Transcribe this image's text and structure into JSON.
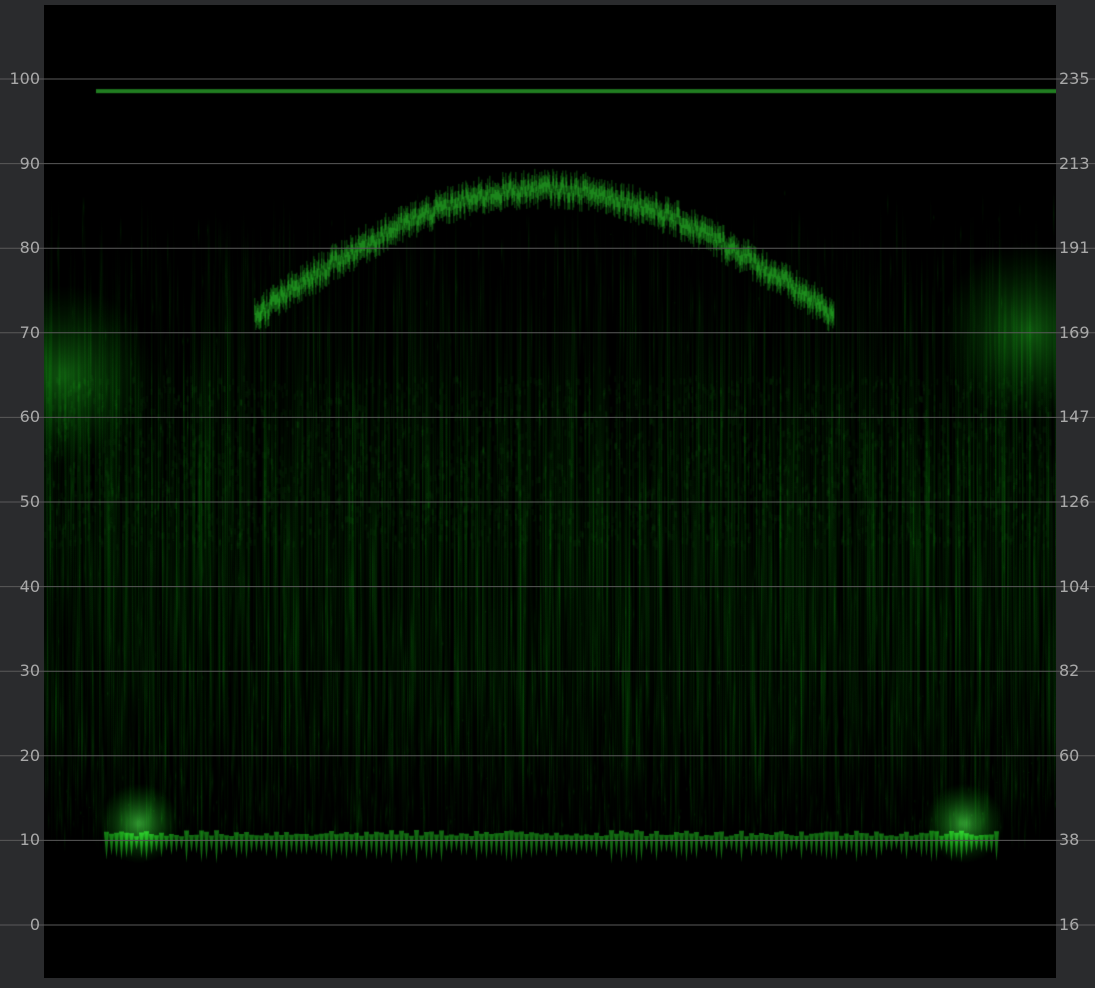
{
  "scope": {
    "type": "luma-waveform",
    "trace_color": "#00e000",
    "background_color": "#000000",
    "frame_color": "#2a2b2d",
    "grid_color": "#5a5a5a",
    "label_color": "#a9a9a9"
  },
  "axes": {
    "left_ticks": [
      "100",
      "90",
      "80",
      "70",
      "60",
      "50",
      "40",
      "30",
      "20",
      "10",
      "0"
    ],
    "right_ticks": [
      "235",
      "213",
      "191",
      "169",
      "147",
      "126",
      "104",
      "82",
      "60",
      "38",
      "16"
    ],
    "left_range": [
      0,
      100
    ],
    "grid": true
  }
}
